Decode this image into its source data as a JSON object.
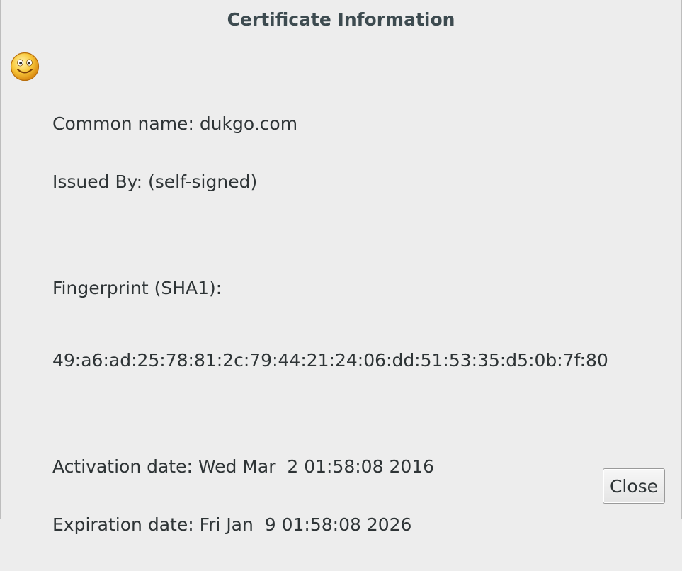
{
  "window": {
    "title": "Certificate Information"
  },
  "icon": {
    "name": "smiley-face-icon"
  },
  "certificate": {
    "common_name": "Common name: dukgo.com",
    "issued_by": "Issued By: (self-signed)",
    "fingerprint_label": "Fingerprint (SHA1):",
    "fingerprint_value": "49:a6:ad:25:78:81:2c:79:44:21:24:06:dd:51:53:35:d5:0b:7f:80",
    "activation_date": "Activation date: Wed Mar  2 01:58:08 2016",
    "expiration_date": "Expiration date: Fri Jan  9 01:58:08 2026"
  },
  "buttons": {
    "close_label": "Close"
  }
}
